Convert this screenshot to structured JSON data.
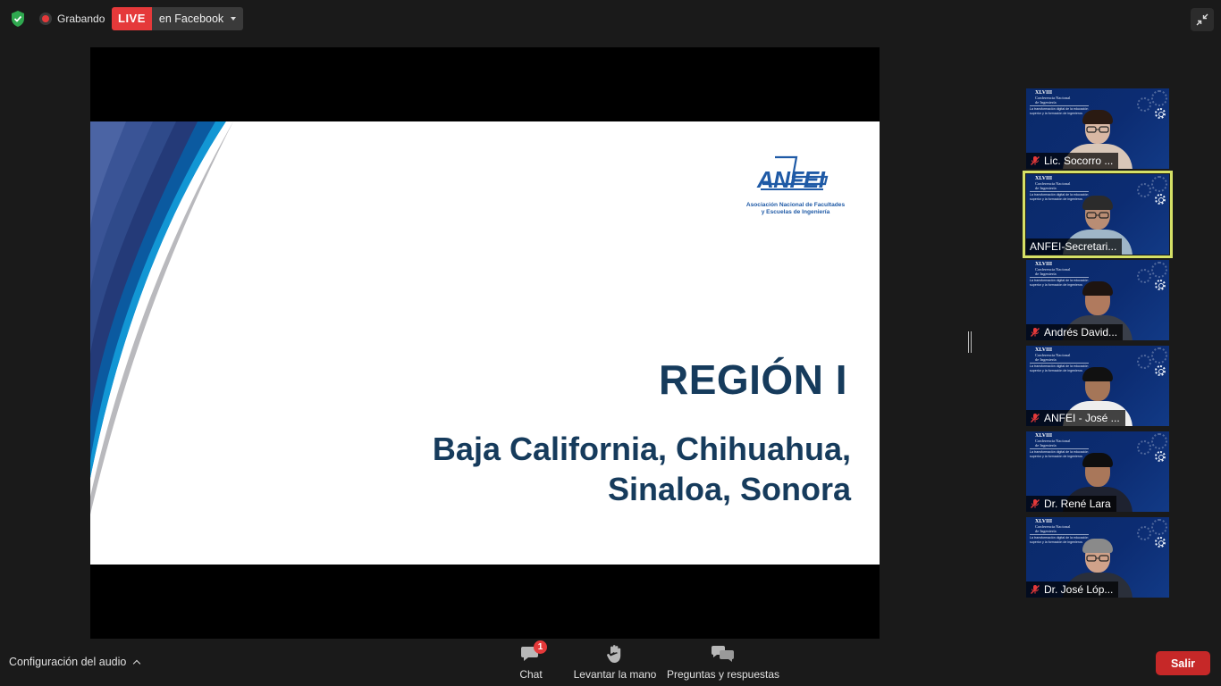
{
  "top_bar": {
    "recording_label": "Grabando",
    "live_badge": "LIVE",
    "live_destination": "en Facebook",
    "icons": {
      "security": "shield-check-icon",
      "recording": "record-icon",
      "dropdown": "caret-down-icon",
      "exit_fullscreen": "minimize-icon"
    }
  },
  "shared_screen": {
    "logo": {
      "wordmark": "ANFEI",
      "subtitle_line1": "Asociación Nacional de Facultades",
      "subtitle_line2": "y Escuelas de Ingeniería"
    },
    "title": "REGIÓN I",
    "states_line1": "Baja California, Chihuahua,",
    "states_line2": "Sinaloa, Sonora"
  },
  "participants": [
    {
      "name": "Lic. Socorro ...",
      "muted": true,
      "active": false
    },
    {
      "name": "ANFEI-Secretari...",
      "muted": false,
      "active": true
    },
    {
      "name": "Andrés David...",
      "muted": true,
      "active": false
    },
    {
      "name": "ANFEI - José ...",
      "muted": true,
      "active": false
    },
    {
      "name": "Dr. René Lara",
      "muted": true,
      "active": false
    },
    {
      "name": "Dr. José Lóp...",
      "muted": true,
      "active": false
    }
  ],
  "tile_banner": {
    "line1": "XLVIII",
    "line2": "Conferencia Nacional",
    "line3": "de Ingeniería",
    "line4": "La transformación digital de la educación superior y la formación de ingenieros"
  },
  "bottom_bar": {
    "audio_settings": "Configuración del audio",
    "chat_label": "Chat",
    "chat_badge": "1",
    "raise_hand_label": "Levantar la mano",
    "qa_label": "Preguntas y respuestas",
    "leave_label": "Salir"
  },
  "colors": {
    "background": "#1a1a1a",
    "live_red": "#e5393a",
    "leave_red": "#c62828",
    "active_speaker": "#d5e066",
    "slide_text": "#163b5c",
    "logo_blue": "#1f5aa6",
    "tile_blue": "#0c2c72"
  }
}
